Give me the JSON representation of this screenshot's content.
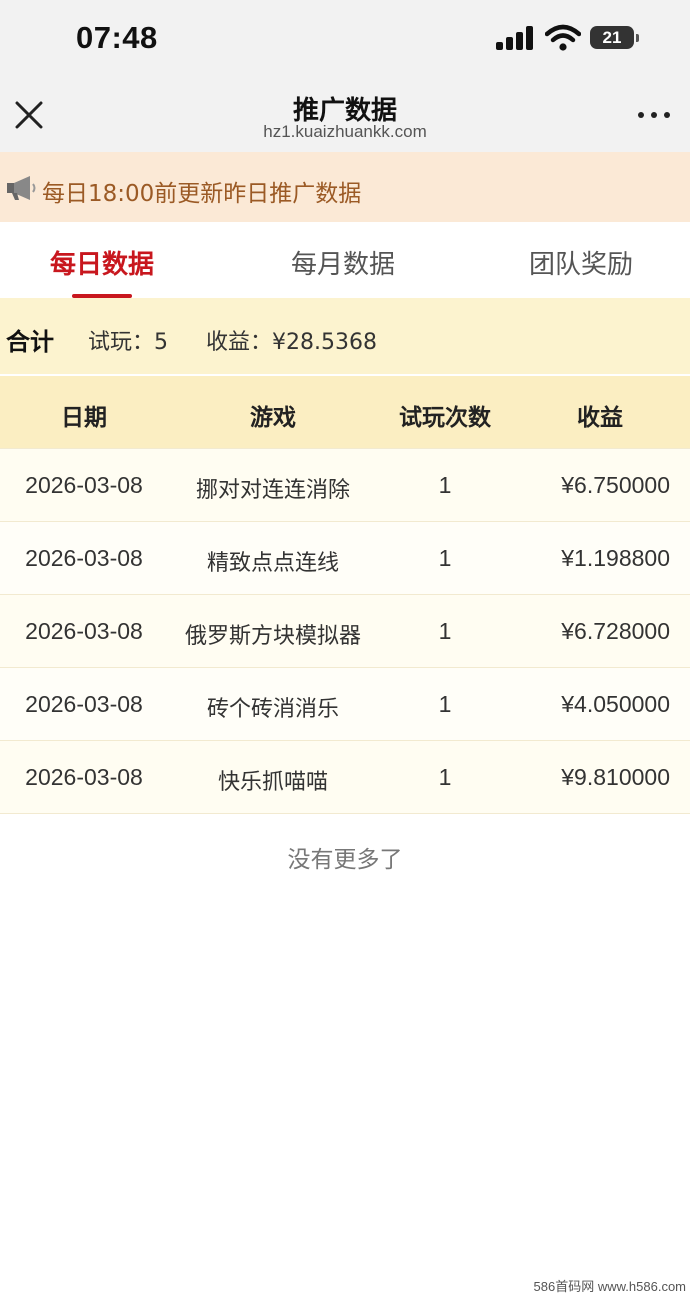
{
  "status_bar": {
    "time": "07:48",
    "battery_level": "21"
  },
  "navbar": {
    "title": "推广数据",
    "url": "hz1.kuaizhuankk.com",
    "close_icon": "close-icon",
    "more_icon": "more-icon"
  },
  "notice": {
    "icon": "megaphone-icon",
    "text": "每日18:00前更新昨日推广数据"
  },
  "tabs": {
    "items": [
      {
        "label": "每日数据",
        "active": true
      },
      {
        "label": "每月数据",
        "active": false
      },
      {
        "label": "团队奖励",
        "active": false
      }
    ],
    "active_color": "#c8171e"
  },
  "summary": {
    "label": "合计",
    "trial_text": "试玩：5",
    "income_text": "收益：¥28.5368"
  },
  "table": {
    "headers": [
      "日期",
      "游戏",
      "试玩次数",
      "收益"
    ],
    "rows": [
      {
        "date": "2026-03-08",
        "game": "挪对对连连消除",
        "count": "1",
        "income": "¥6.750000"
      },
      {
        "date": "2026-03-08",
        "game": "精致点点连线",
        "count": "1",
        "income": "¥1.198800"
      },
      {
        "date": "2026-03-08",
        "game": "俄罗斯方块模拟器",
        "count": "1",
        "income": "¥6.728000"
      },
      {
        "date": "2026-03-08",
        "game": "砖个砖消消乐",
        "count": "1",
        "income": "¥4.050000"
      },
      {
        "date": "2026-03-08",
        "game": "快乐抓喵喵",
        "count": "1",
        "income": "¥9.810000"
      }
    ]
  },
  "footer": {
    "no_more": "没有更多了"
  },
  "watermark": "586首码网 www.h586.com"
}
